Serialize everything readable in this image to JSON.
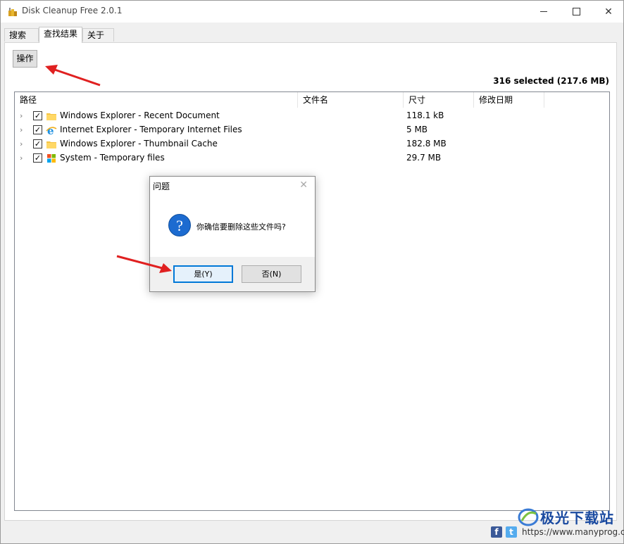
{
  "window": {
    "title": "Disk Cleanup Free 2.0.1"
  },
  "tabs": [
    {
      "label": "搜索",
      "active": false
    },
    {
      "label": "查找结果",
      "active": true
    },
    {
      "label": "关于",
      "active": false
    }
  ],
  "toolbar": {
    "operate_label": "操作"
  },
  "status": {
    "selected_text": "316 selected (217.6 MB)"
  },
  "tree": {
    "columns": [
      "路径",
      "文件名",
      "尺寸",
      "修改日期"
    ],
    "rows": [
      {
        "path": "Windows Explorer - Recent Document",
        "size": "118.1 kB",
        "checked": true,
        "icon": "folder-icon"
      },
      {
        "path": "Internet Explorer - Temporary Internet Files",
        "size": "5 MB",
        "checked": true,
        "icon": "internet-explorer-icon"
      },
      {
        "path": "Windows Explorer - Thumbnail Cache",
        "size": "182.8 MB",
        "checked": true,
        "icon": "folder-icon"
      },
      {
        "path": "System - Temporary files",
        "size": "29.7 MB",
        "checked": true,
        "icon": "windows-logo-icon"
      }
    ]
  },
  "dialog": {
    "title": "问题",
    "message": "你确信要删除这些文件吗?",
    "yes_label": "是(Y)",
    "no_label": "否(N)",
    "icon": "question-icon"
  },
  "footer": {
    "watermark_title": "极光下载站",
    "watermark_url": "https://www.manyprog.com",
    "social": [
      "facebook-icon",
      "twitter-icon"
    ]
  },
  "colors": {
    "accent": "#0078d7",
    "annotation_arrow": "#e02020"
  }
}
